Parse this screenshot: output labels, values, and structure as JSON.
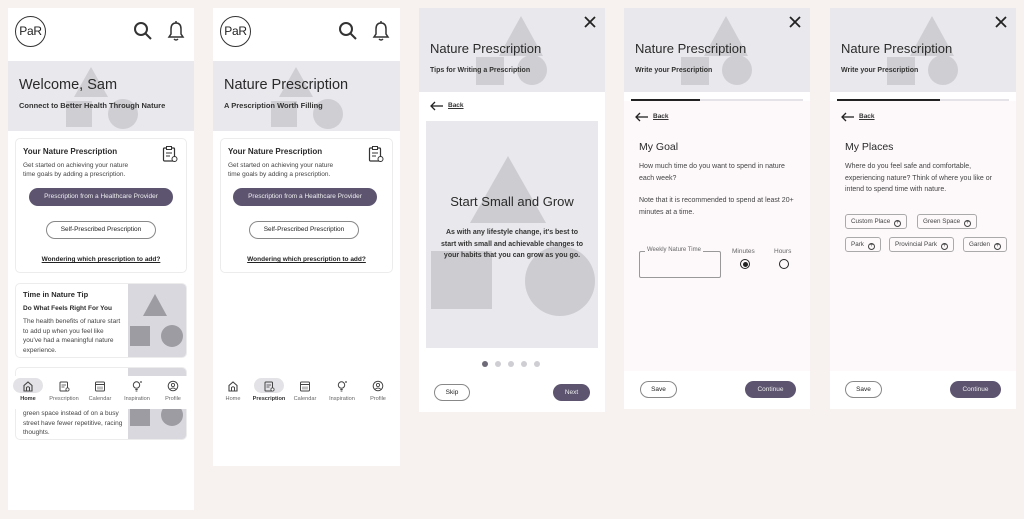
{
  "app": {
    "logo": "PaR"
  },
  "screens": {
    "home": {
      "hero": {
        "title": "Welcome, Sam",
        "subtitle": "Connect to Better Health Through Nature"
      },
      "prescription_card": {
        "title": "Your Nature Prescription",
        "body": "Get started on achieving your nature time goals by adding a prescription.",
        "primary_button": "Prescription from a Healthcare Provider",
        "secondary_button": "Self-Prescribed Prescription",
        "help_link": "Wondering which prescription to add?"
      },
      "tip_card": {
        "title": "Time in Nature Tip",
        "subtitle": "Do What Feels Right For You",
        "body": "The health benefits of nature start to add up when you feel like you've had a meaningful nature experience."
      },
      "tip_card_2": {
        "body": "green space instead of on a busy street have fewer repetitive, racing thoughts."
      },
      "active_nav": "Home"
    },
    "prescription": {
      "hero": {
        "title": "Nature Prescription",
        "subtitle": "A Prescription Worth Filling"
      },
      "prescription_card": {
        "title": "Your Nature Prescription",
        "body": "Get started on achieving your nature time goals by adding a prescription.",
        "primary_button": "Prescription from a Healthcare Provider",
        "secondary_button": "Self-Prescribed Prescription",
        "help_link": "Wondering which prescription to add?"
      },
      "active_nav": "Prescription"
    },
    "tips": {
      "hero": {
        "title": "Nature Prescription",
        "subtitle": "Tips for Writing a Prescription"
      },
      "back": "Back",
      "slide": {
        "title": "Start Small and Grow",
        "body": "As with any lifestyle change, it's best to start with small and achievable changes to your habits that you can grow as you go."
      },
      "pagination": {
        "total": 5,
        "current": 1
      },
      "skip": "Skip",
      "next": "Next"
    },
    "goal": {
      "hero": {
        "title": "Nature Prescription",
        "subtitle": "Write your Prescription"
      },
      "progress": 0.4,
      "back": "Back",
      "title": "My Goal",
      "question": "How much time do you want to spend in nature each week?",
      "note": "Note that it is recommended to spend at least 20+ minutes at a time.",
      "field": {
        "label": "Weekly Nature Time",
        "value": ""
      },
      "units": [
        {
          "label": "Minutes",
          "checked": true
        },
        {
          "label": "Hours",
          "checked": false
        }
      ],
      "save": "Save",
      "continue": "Continue"
    },
    "places": {
      "hero": {
        "title": "Nature Prescription",
        "subtitle": "Write your Prescription"
      },
      "progress": 0.6,
      "back": "Back",
      "title": "My Places",
      "question": "Where do you feel safe and comfortable, experiencing nature? Think of where you like or intend to spend time with nature.",
      "chips": [
        "Custom Place",
        "Green Space",
        "Park",
        "Provincial Park",
        "Garden"
      ],
      "save": "Save",
      "continue": "Continue"
    }
  },
  "nav": {
    "items": [
      {
        "label": "Home",
        "icon": "home-icon"
      },
      {
        "label": "Prescription",
        "icon": "clipboard-icon"
      },
      {
        "label": "Calendar",
        "icon": "calendar-icon"
      },
      {
        "label": "Inspiration",
        "icon": "lightbulb-icon"
      },
      {
        "label": "Profile",
        "icon": "profile-icon"
      }
    ]
  },
  "colors": {
    "primary": "#5d5470",
    "hero_bg": "#e9e8ec",
    "page_bg": "#f7f2ef",
    "shape": "#cfcfd3"
  }
}
